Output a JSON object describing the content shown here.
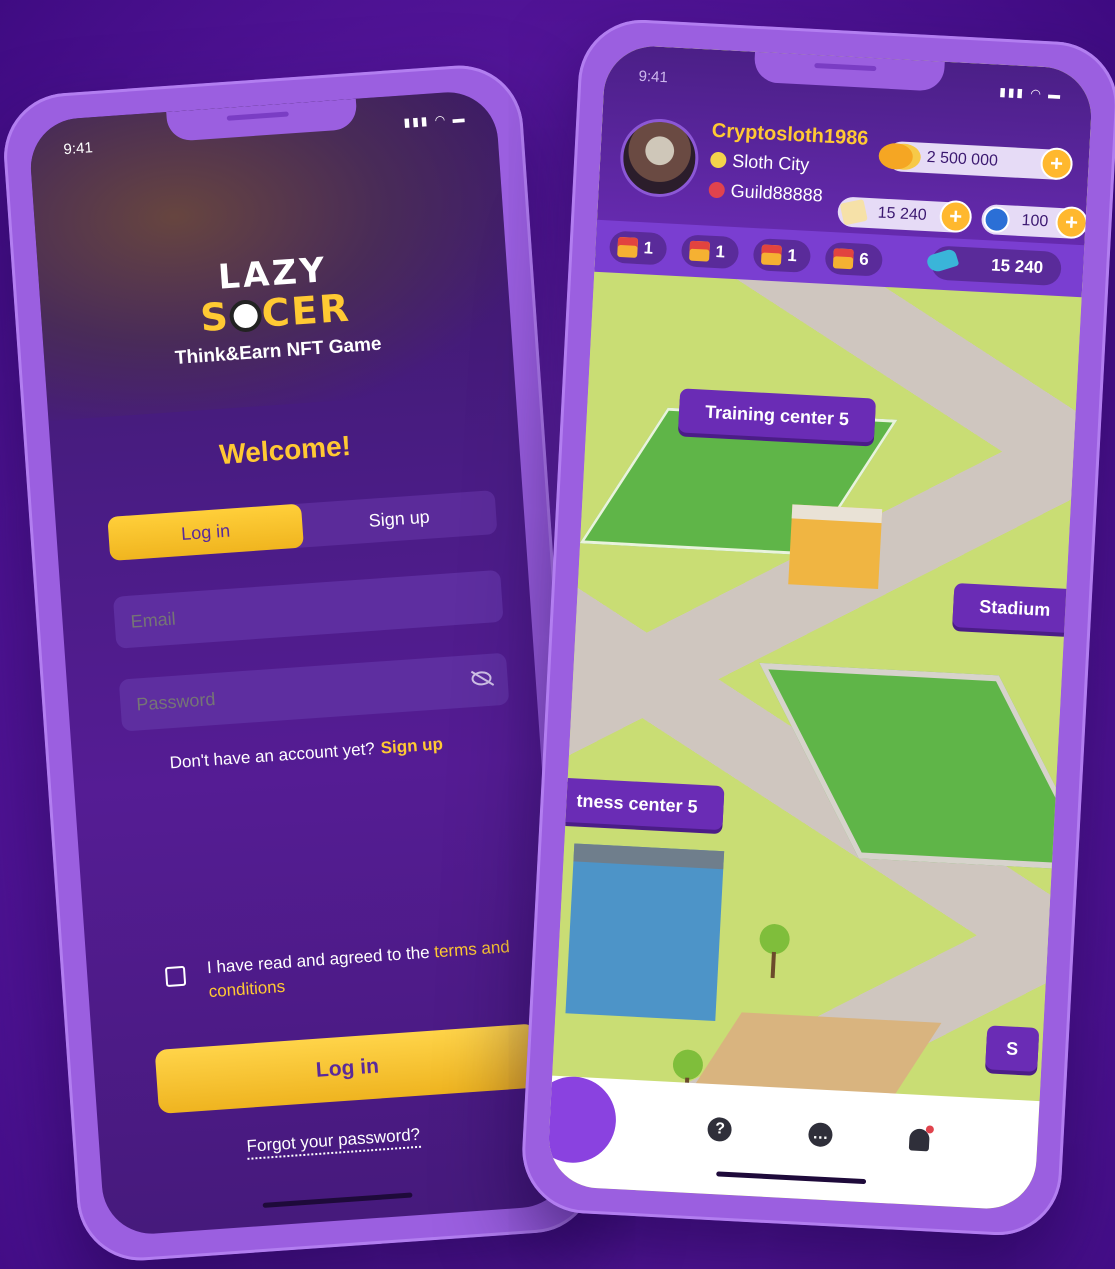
{
  "left_phone": {
    "time": "9:41",
    "logo_line1": "LAZY",
    "logo_line2a": "S",
    "logo_line2b": "CER",
    "tagline": "Think&Earn NFT Game",
    "welcome": "Welcome!",
    "tabs": {
      "login": "Log in",
      "signup": "Sign up"
    },
    "email": {
      "placeholder": "Email",
      "value": ""
    },
    "password": {
      "placeholder": "Password",
      "value": ""
    },
    "no_account_text": "Don't have an account yet?",
    "no_account_link": "Sign up",
    "terms_text": "I have read and agreed to the",
    "terms_link": "terms and conditions",
    "terms_checked": false,
    "login_button": "Log in",
    "forgot_password": "Forgot your password?"
  },
  "right_phone": {
    "time": "9:41",
    "username": "Cryptosloth1986",
    "city": "Sloth City",
    "guild": "Guild88888",
    "coins": "2 500 000",
    "tickets": "15 240",
    "tokens": "100",
    "gifts": [
      "1",
      "1",
      "1",
      "6"
    ],
    "boots": "15 240",
    "map_labels": {
      "training": "Training center 5",
      "stadium": "Stadium",
      "fitness": "tness center 5",
      "edge": "S"
    },
    "nav_icons": [
      "help-icon",
      "chat-icon",
      "bell-icon"
    ]
  },
  "colors": {
    "accent_yellow": "#ffc933",
    "purple": "#6a2cb5",
    "background": "#5e1aa6"
  }
}
